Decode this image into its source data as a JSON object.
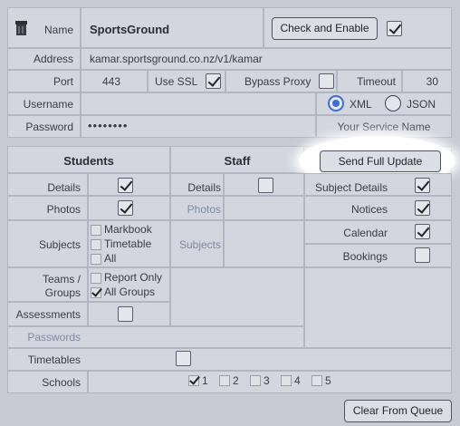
{
  "connection": {
    "name_label": "Name",
    "name_value": "SportsGround",
    "check_enable_button": "Check and Enable",
    "check_enable_checked": true,
    "address_label": "Address",
    "address_value": "kamar.sportsground.co.nz/v1/kamar",
    "port_label": "Port",
    "port_value": "443",
    "use_ssl_label": "Use SSL",
    "use_ssl_checked": true,
    "bypass_proxy_label": "Bypass Proxy",
    "bypass_proxy_checked": false,
    "timeout_label": "Timeout",
    "timeout_value": "30",
    "username_label": "Username",
    "username_value": "",
    "format_xml_label": "XML",
    "format_json_label": "JSON",
    "format_selected": "XML",
    "password_label": "Password",
    "password_value": "••••••••",
    "service_name_placeholder": "Your Service Name",
    "app_icon": "database-icon"
  },
  "sections": {
    "students_header": "Students",
    "staff_header": "Staff",
    "send_full_update_button": "Send Full Update"
  },
  "students": {
    "details_label": "Details",
    "details_checked": true,
    "photos_label": "Photos",
    "photos_checked": true,
    "subjects_label": "Subjects",
    "subjects_options": [
      {
        "label": "Markbook",
        "checked": false
      },
      {
        "label": "Timetable",
        "checked": false
      },
      {
        "label": "All",
        "checked": false
      }
    ],
    "teams_groups_label_1": "Teams /",
    "teams_groups_label_2": "Groups",
    "teams_options": [
      {
        "label": "Report Only",
        "checked": false
      },
      {
        "label": "All Groups",
        "checked": true
      }
    ],
    "assessments_label": "Assessments",
    "assessments_checked": false,
    "passwords_label": "Passwords",
    "timetables_label": "Timetables",
    "timetables_checked": false,
    "schools_label": "Schools",
    "schools": [
      {
        "label": "1",
        "checked": true
      },
      {
        "label": "2",
        "checked": false
      },
      {
        "label": "3",
        "checked": false
      },
      {
        "label": "4",
        "checked": false
      },
      {
        "label": "5",
        "checked": false
      }
    ]
  },
  "staff": {
    "details_label": "Details",
    "details_checked": false,
    "photos_label": "Photos",
    "subjects_label": "Subjects"
  },
  "other": {
    "subject_details_label": "Subject Details",
    "subject_details_checked": true,
    "notices_label": "Notices",
    "notices_checked": true,
    "calendar_label": "Calendar",
    "calendar_checked": true,
    "bookings_label": "Bookings",
    "bookings_checked": false
  },
  "footer": {
    "clear_queue_button": "Clear From Queue"
  },
  "colors": {
    "background": "#c8cbd3",
    "panel": "#d3d6df",
    "muted_text": "#7d8aa3",
    "radio_accent": "#3d6fd0"
  }
}
